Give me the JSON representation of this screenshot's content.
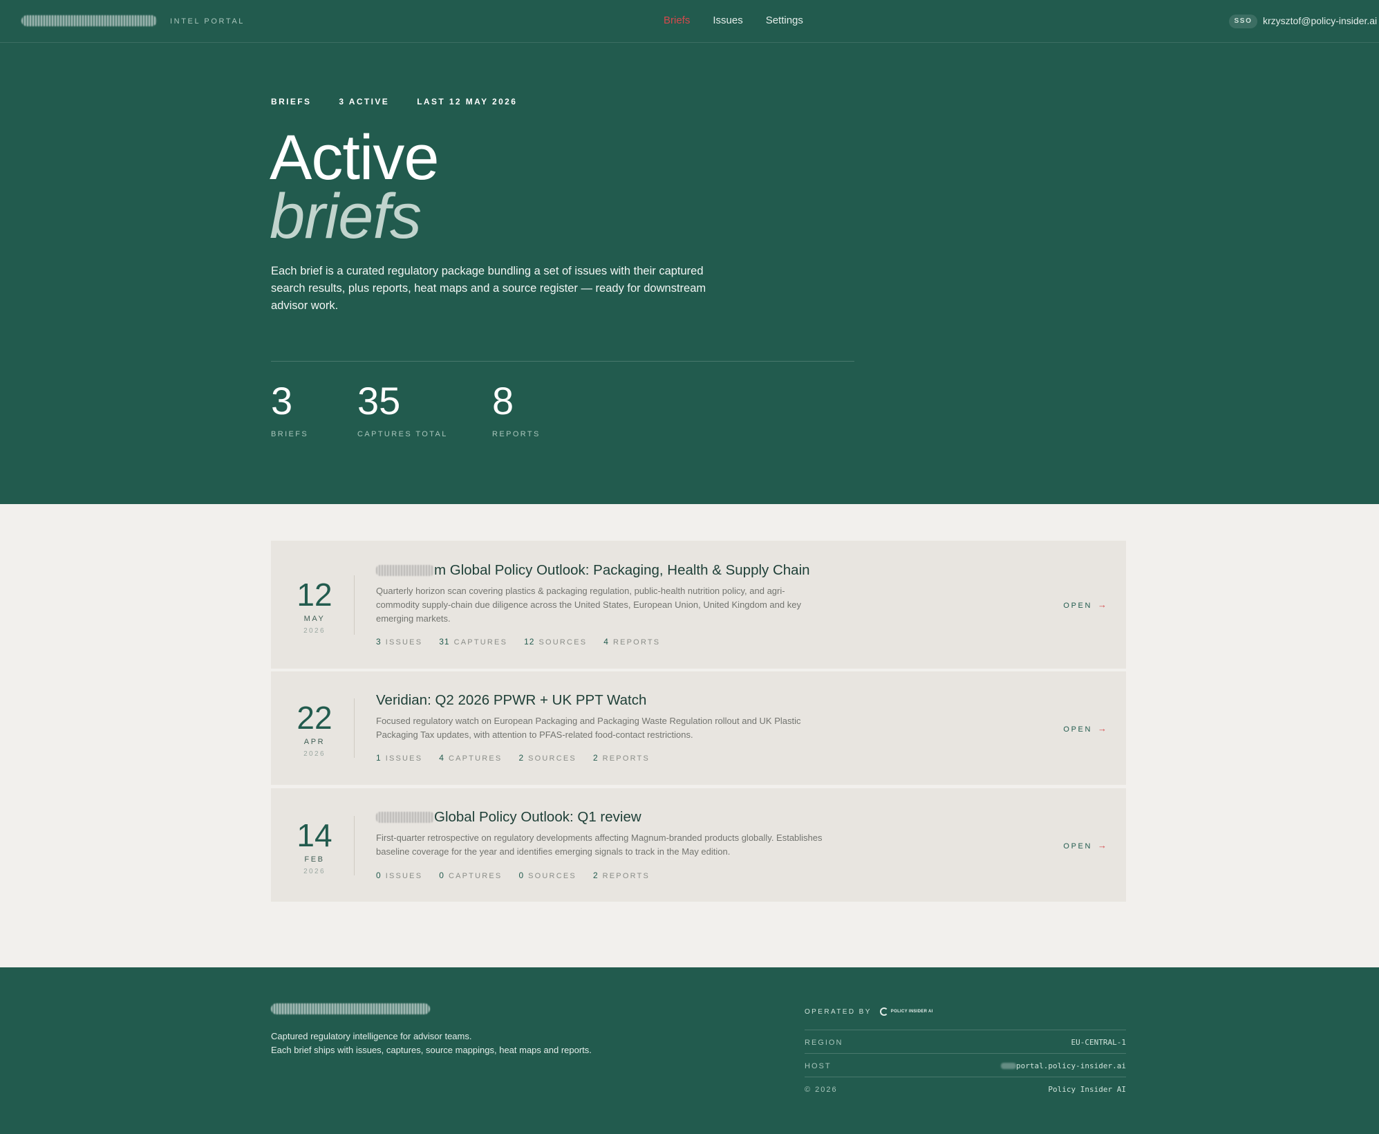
{
  "nav": {
    "brand_sub": "INTEL PORTAL",
    "links": [
      "Briefs",
      "Issues",
      "Settings"
    ],
    "active_link": "Briefs",
    "sso_badge": "SSO",
    "user_email": "krzysztof@policy-insider.ai"
  },
  "hero": {
    "meta": [
      "BRIEFS",
      "3 ACTIVE",
      "LAST 12 MAY 2026"
    ],
    "title_line1": "Active",
    "title_line2": "briefs",
    "description": "Each brief is a curated regulatory package bundling a set of issues with their captured search results, plus reports, heat maps and a source register — ready for downstream advisor work.",
    "stats": [
      {
        "value": "3",
        "label": "BRIEFS"
      },
      {
        "value": "35",
        "label": "CAPTURES TOTAL"
      },
      {
        "value": "8",
        "label": "REPORTS"
      }
    ]
  },
  "briefs": [
    {
      "day": "12",
      "month": "MAY",
      "year": "2026",
      "title_prefix": "m",
      "title": " Global Policy Outlook: Packaging, Health & Supply Chain",
      "description": "Quarterly horizon scan covering plastics & packaging regulation, public-health nutrition policy, and agri-commodity supply-chain due diligence across the United States, European Union, United Kingdom and key emerging markets.",
      "issues": "3",
      "captures": "31",
      "sources": "12",
      "reports": "4",
      "open_label": "OPEN"
    },
    {
      "day": "22",
      "month": "APR",
      "year": "2026",
      "title_prefix": "",
      "title": "Veridian: Q2 2026 PPWR + UK PPT Watch",
      "description": "Focused regulatory watch on European Packaging and Packaging Waste Regulation rollout and UK Plastic Packaging Tax updates, with attention to PFAS-related food-contact restrictions.",
      "issues": "1",
      "captures": "4",
      "sources": "2",
      "reports": "2",
      "open_label": "OPEN"
    },
    {
      "day": "14",
      "month": "FEB",
      "year": "2026",
      "title_prefix": "",
      "title": "Global Policy Outlook: Q1 review",
      "description": "First-quarter retrospective on regulatory developments affecting Magnum-branded products globally. Establishes baseline coverage for the year and identifies emerging signals to track in the May edition.",
      "issues": "0",
      "captures": "0",
      "sources": "0",
      "reports": "2",
      "open_label": "OPEN"
    }
  ],
  "count_labels": {
    "issues": "ISSUES",
    "captures": "CAPTURES",
    "sources": "SOURCES",
    "reports": "REPORTS"
  },
  "footer": {
    "tagline_1": "Captured regulatory intelligence for advisor teams.",
    "tagline_2": "Each brief ships with issues, captures, source mappings, heat maps and reports.",
    "operated_by": "OPERATED BY",
    "operator_logo_text": "POLICY INSIDER AI",
    "rows": [
      {
        "key": "REGION",
        "value": "EU-CENTRAL-1"
      },
      {
        "key": "HOST",
        "value": "portal.policy-insider.ai"
      },
      {
        "key": "© 2026",
        "value": "Policy Insider AI"
      }
    ]
  },
  "colors": {
    "primary": "#225b4e",
    "accent": "#d4494c",
    "paper": "#f2f0ed",
    "card": "#e8e5e0"
  }
}
